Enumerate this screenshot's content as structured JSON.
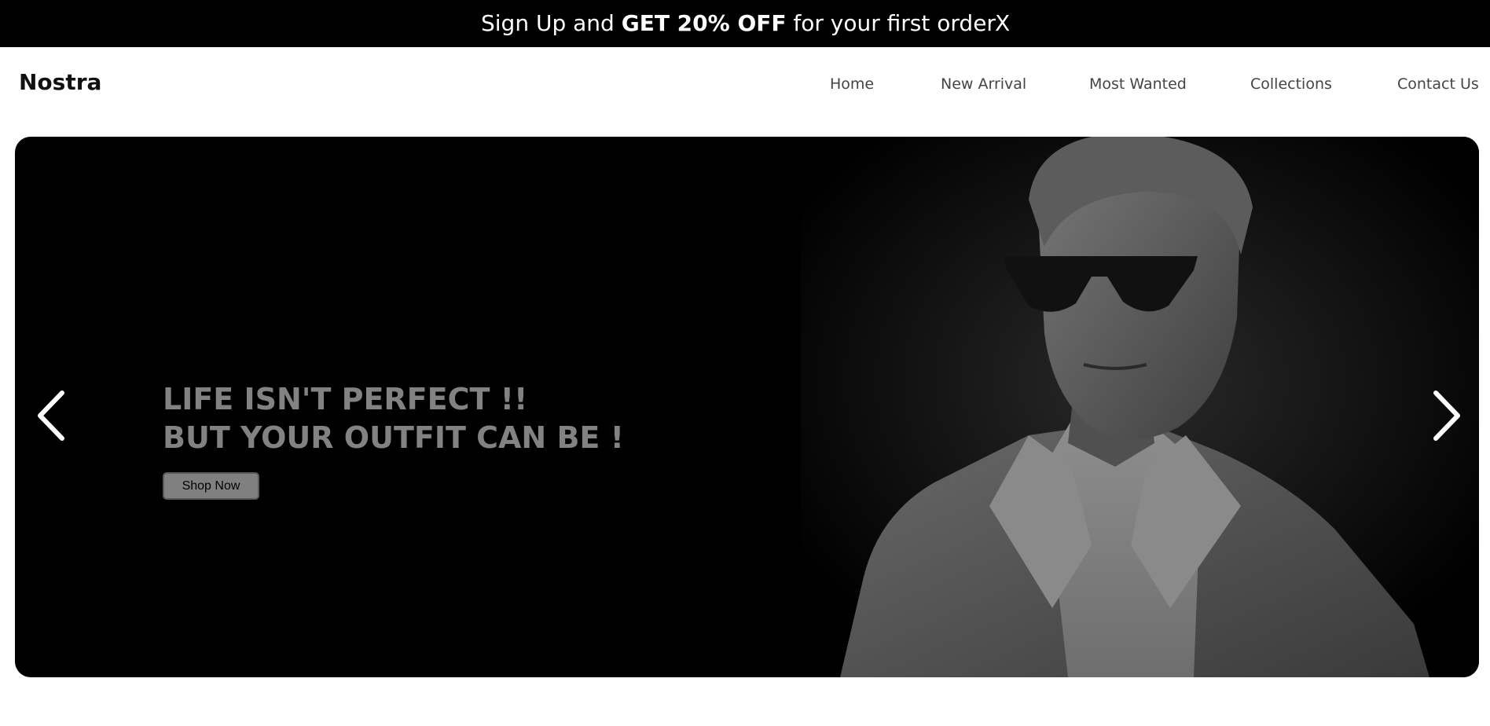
{
  "announcement": {
    "text_before": "Sign Up and ",
    "text_bold": "GET 20% OFF",
    "text_after": " for your first order",
    "close_label": "X"
  },
  "header": {
    "logo": "Nostra",
    "nav": [
      {
        "label": "Home"
      },
      {
        "label": "New Arrival"
      },
      {
        "label": "Most Wanted"
      },
      {
        "label": "Collections"
      },
      {
        "label": "Contact Us"
      }
    ]
  },
  "hero": {
    "heading_line1": "LIFE ISN'T PERFECT !!",
    "heading_line2": "BUT YOUR OUTFIT CAN BE !",
    "cta_label": "Shop Now",
    "prev_icon": "chevron-left-icon",
    "next_icon": "chevron-right-icon",
    "image_subject": "man-in-sunglasses-and-suit-icon"
  },
  "colors": {
    "banner_bg": "#000000",
    "hero_bg": "#000000",
    "heading": "#828282",
    "button_bg": "#808080"
  }
}
